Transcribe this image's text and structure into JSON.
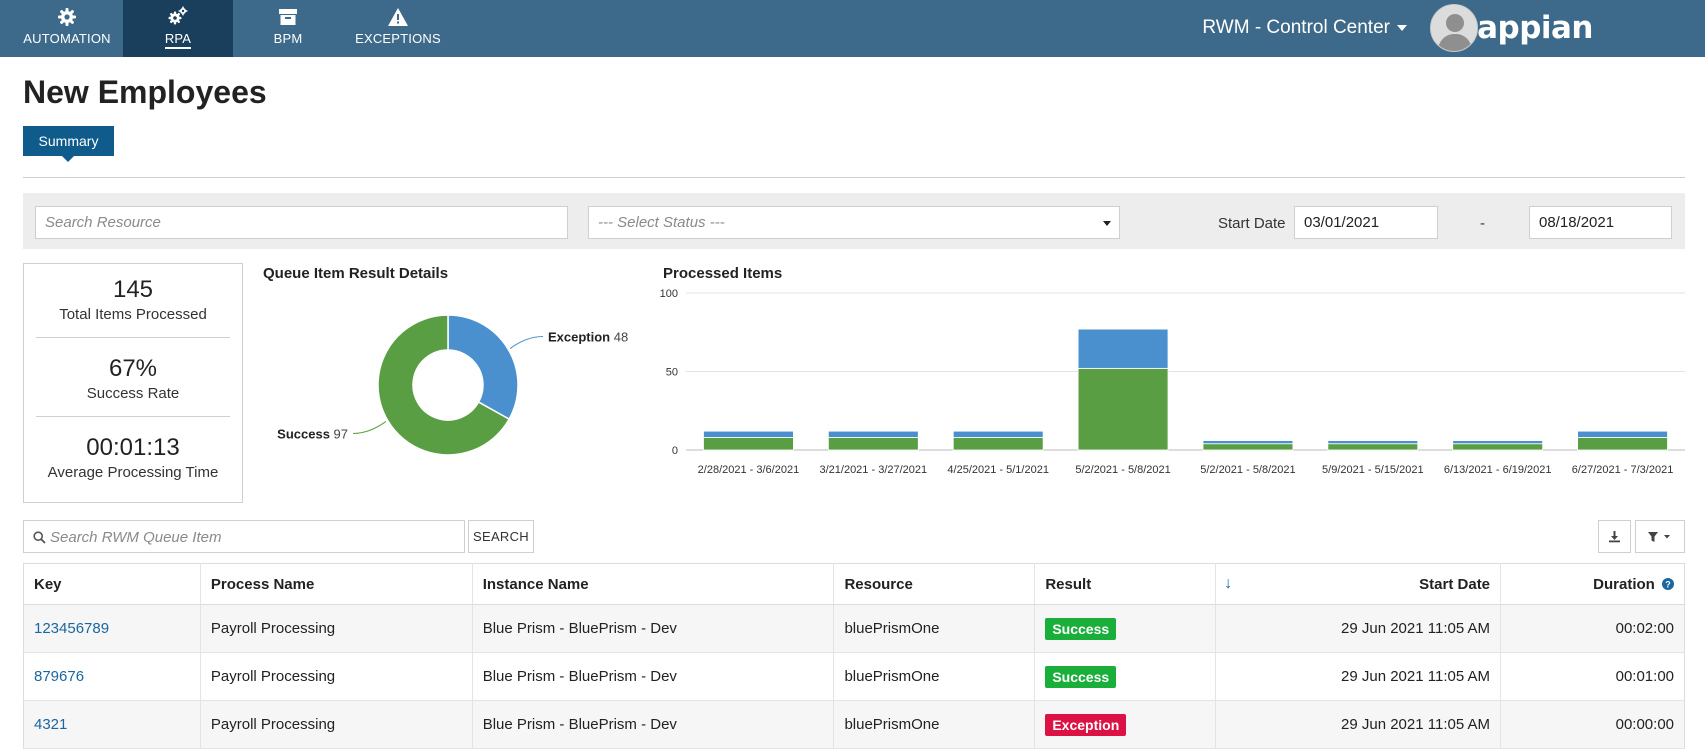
{
  "nav": {
    "items": [
      {
        "label": "AUTOMATION",
        "icon": "gear-icon"
      },
      {
        "label": "RPA",
        "icon": "gears-icon",
        "active": true
      },
      {
        "label": "BPM",
        "icon": "archive-box-icon"
      },
      {
        "label": "EXCEPTIONS",
        "icon": "warning-icon"
      }
    ],
    "environment": "RWM - Control Center",
    "logo": "appian"
  },
  "page": {
    "title": "New Employees",
    "tab": "Summary"
  },
  "filters": {
    "resource_placeholder": "Search Resource",
    "status_placeholder": "--- Select Status ---",
    "start_date_label": "Start Date",
    "start_date": "03/01/2021",
    "range_dash": "-",
    "end_date": "08/18/2021"
  },
  "kpis": [
    {
      "value": "145",
      "caption": "Total Items Processed"
    },
    {
      "value": "67%",
      "caption": "Success Rate"
    },
    {
      "value": "00:01:13",
      "caption": "Average Processing Time"
    }
  ],
  "colors": {
    "success": "#5a9e43",
    "exception": "#4a90cf",
    "nav_bg": "#3d6a8a",
    "nav_active": "#1a3f5c",
    "tab_bg": "#0f5b8c",
    "badge_success": "#1aae3a",
    "badge_exception": "#dc1144"
  },
  "chart_data": [
    {
      "type": "pie",
      "title": "Queue Item Result Details",
      "donut": true,
      "slices": [
        {
          "name": "Exception",
          "value": 48,
          "color": "#4a90cf"
        },
        {
          "name": "Success",
          "value": 97,
          "color": "#5a9e43"
        }
      ]
    },
    {
      "type": "bar",
      "stacked": true,
      "title": "Processed Items",
      "categories": [
        "2/28/2021 - 3/6/2021",
        "3/21/2021 - 3/27/2021",
        "4/25/2021 - 5/1/2021",
        "5/2/2021 - 5/8/2021",
        "5/2/2021 - 5/8/2021",
        "5/9/2021 - 5/15/2021",
        "6/13/2021 - 6/19/2021",
        "6/27/2021 - 7/3/2021"
      ],
      "series": [
        {
          "name": "Success",
          "values": [
            8,
            8,
            8,
            52,
            4,
            4,
            4,
            8
          ],
          "color": "#5a9e43"
        },
        {
          "name": "Exception",
          "values": [
            4,
            4,
            4,
            25,
            2,
            2,
            2,
            4
          ],
          "color": "#4a90cf"
        }
      ],
      "ylim": [
        0,
        100
      ],
      "yticks": [
        0,
        50,
        100
      ],
      "grid": true
    }
  ],
  "table": {
    "search_placeholder": "Search RWM Queue Item",
    "search_button": "SEARCH",
    "sort_arrow": "↓",
    "columns": [
      "Key",
      "Process Name",
      "Instance Name",
      "Resource",
      "Result",
      "Start Date",
      "Duration"
    ],
    "rows": [
      {
        "key": "123456789",
        "process": "Payroll Processing",
        "instance": "Blue Prism - BluePrism - Dev",
        "resource": "bluePrismOne",
        "result": "Success",
        "start": "29 Jun 2021 11:05 AM",
        "duration": "00:02:00"
      },
      {
        "key": "879676",
        "process": "Payroll Processing",
        "instance": "Blue Prism - BluePrism - Dev",
        "resource": "bluePrismOne",
        "result": "Success",
        "start": "29 Jun 2021 11:05 AM",
        "duration": "00:01:00"
      },
      {
        "key": "4321",
        "process": "Payroll Processing",
        "instance": "Blue Prism - BluePrism - Dev",
        "resource": "bluePrismOne",
        "result": "Exception",
        "start": "29 Jun 2021 11:05 AM",
        "duration": "00:00:00"
      }
    ]
  }
}
